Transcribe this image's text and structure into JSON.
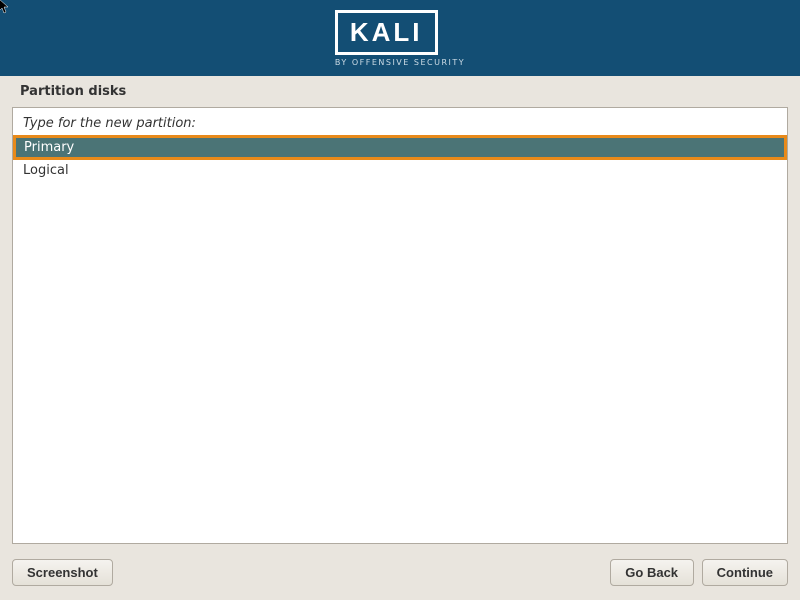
{
  "header": {
    "logo_text": "KALI",
    "logo_subtitle": "BY OFFENSIVE SECURITY"
  },
  "title": "Partition disks",
  "prompt": "Type for the new partition:",
  "options": [
    {
      "label": "Primary",
      "selected": true
    },
    {
      "label": "Logical",
      "selected": false
    }
  ],
  "buttons": {
    "screenshot": "Screenshot",
    "go_back": "Go Back",
    "continue": "Continue"
  }
}
